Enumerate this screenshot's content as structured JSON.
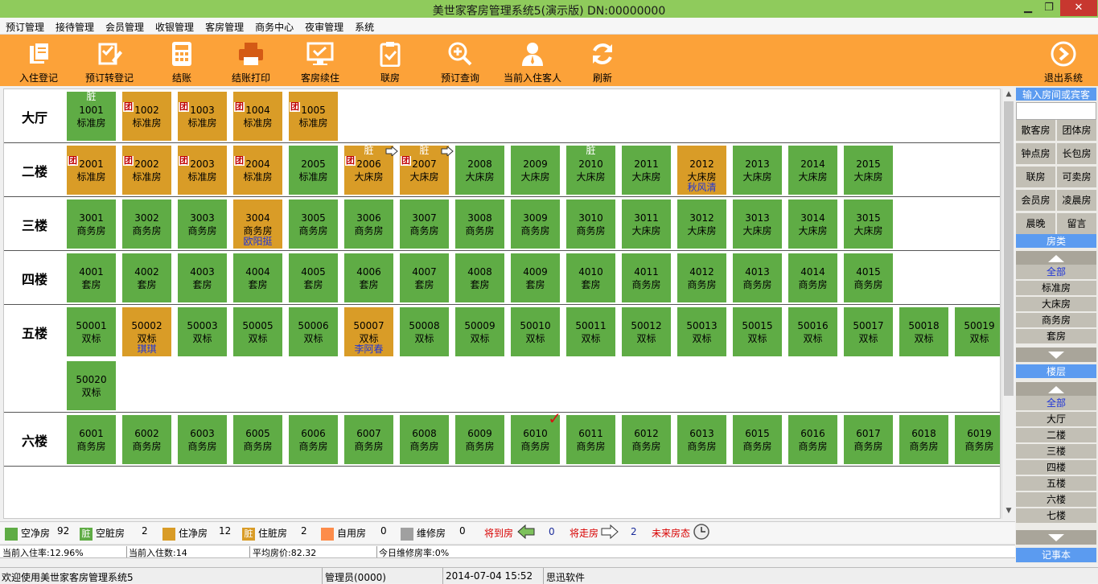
{
  "window": {
    "title": "美世家客房管理系统5(演示版) DN:00000000",
    "min": "▁",
    "restore": "❐",
    "close": "✕"
  },
  "menu": [
    "预订管理",
    "接待管理",
    "会员管理",
    "收银管理",
    "客房管理",
    "商务中心",
    "夜审管理",
    "系统"
  ],
  "toolbar": {
    "buttons": [
      {
        "label": "入住登记",
        "icon": "checkin-icon"
      },
      {
        "label": "预订转登记",
        "icon": "reservation-convert-icon"
      },
      {
        "label": "结账",
        "icon": "calculator-icon"
      },
      {
        "label": "结账打印",
        "icon": "printer-icon"
      },
      {
        "label": "客房续住",
        "icon": "monitor-check-icon"
      },
      {
        "label": "联房",
        "icon": "clipboard-check-icon"
      },
      {
        "label": "预订查询",
        "icon": "search-plus-icon"
      },
      {
        "label": "当前入住客人",
        "icon": "guest-icon"
      },
      {
        "label": "刷新",
        "icon": "refresh-icon"
      }
    ],
    "exit": {
      "label": "退出系统",
      "icon": "exit-arrow-icon"
    }
  },
  "room_markers": {
    "dirty": "脏",
    "group": "团"
  },
  "floors": [
    {
      "name": "大厅",
      "rooms": [
        {
          "no": "1001",
          "type": "标准房",
          "color": "green",
          "dirty": true
        },
        {
          "no": "1002",
          "type": "标准房",
          "color": "orange",
          "group": true
        },
        {
          "no": "1003",
          "type": "标准房",
          "color": "orange",
          "group": true
        },
        {
          "no": "1004",
          "type": "标准房",
          "color": "orange",
          "group": true
        },
        {
          "no": "1005",
          "type": "标准房",
          "color": "orange",
          "group": true
        }
      ]
    },
    {
      "name": "二楼",
      "rooms": [
        {
          "no": "2001",
          "type": "标准房",
          "color": "orange",
          "group": true
        },
        {
          "no": "2002",
          "type": "标准房",
          "color": "orange",
          "group": true
        },
        {
          "no": "2003",
          "type": "标准房",
          "color": "orange",
          "group": true
        },
        {
          "no": "2004",
          "type": "标准房",
          "color": "orange",
          "group": true
        },
        {
          "no": "2005",
          "type": "标准房",
          "color": "green"
        },
        {
          "no": "2006",
          "type": "大床房",
          "color": "orange",
          "group": true,
          "dirty": true,
          "leaving": true
        },
        {
          "no": "2007",
          "type": "大床房",
          "color": "orange",
          "group": true,
          "dirty": true,
          "leaving": true
        },
        {
          "no": "2008",
          "type": "大床房",
          "color": "green"
        },
        {
          "no": "2009",
          "type": "大床房",
          "color": "green"
        },
        {
          "no": "2010",
          "type": "大床房",
          "color": "green",
          "dirty": true
        },
        {
          "no": "2011",
          "type": "大床房",
          "color": "green"
        },
        {
          "no": "2012",
          "type": "大床房",
          "color": "orange",
          "guest": "秋风清"
        },
        {
          "no": "2013",
          "type": "大床房",
          "color": "green"
        },
        {
          "no": "2014",
          "type": "大床房",
          "color": "green"
        },
        {
          "no": "2015",
          "type": "大床房",
          "color": "green"
        }
      ]
    },
    {
      "name": "三楼",
      "rooms": [
        {
          "no": "3001",
          "type": "商务房",
          "color": "green"
        },
        {
          "no": "3002",
          "type": "商务房",
          "color": "green"
        },
        {
          "no": "3003",
          "type": "商务房",
          "color": "green"
        },
        {
          "no": "3004",
          "type": "商务房",
          "color": "orange",
          "guest": "欧阳挺"
        },
        {
          "no": "3005",
          "type": "商务房",
          "color": "green"
        },
        {
          "no": "3006",
          "type": "商务房",
          "color": "green"
        },
        {
          "no": "3007",
          "type": "商务房",
          "color": "green"
        },
        {
          "no": "3008",
          "type": "商务房",
          "color": "green"
        },
        {
          "no": "3009",
          "type": "商务房",
          "color": "green"
        },
        {
          "no": "3010",
          "type": "商务房",
          "color": "green"
        },
        {
          "no": "3011",
          "type": "大床房",
          "color": "green"
        },
        {
          "no": "3012",
          "type": "大床房",
          "color": "green"
        },
        {
          "no": "3013",
          "type": "大床房",
          "color": "green"
        },
        {
          "no": "3014",
          "type": "大床房",
          "color": "green"
        },
        {
          "no": "3015",
          "type": "大床房",
          "color": "green"
        }
      ]
    },
    {
      "name": "四楼",
      "rooms": [
        {
          "no": "4001",
          "type": "套房",
          "color": "green"
        },
        {
          "no": "4002",
          "type": "套房",
          "color": "green"
        },
        {
          "no": "4003",
          "type": "套房",
          "color": "green"
        },
        {
          "no": "4004",
          "type": "套房",
          "color": "green"
        },
        {
          "no": "4005",
          "type": "套房",
          "color": "green"
        },
        {
          "no": "4006",
          "type": "套房",
          "color": "green"
        },
        {
          "no": "4007",
          "type": "套房",
          "color": "green"
        },
        {
          "no": "4008",
          "type": "套房",
          "color": "green"
        },
        {
          "no": "4009",
          "type": "套房",
          "color": "green"
        },
        {
          "no": "4010",
          "type": "套房",
          "color": "green"
        },
        {
          "no": "4011",
          "type": "商务房",
          "color": "green"
        },
        {
          "no": "4012",
          "type": "商务房",
          "color": "green"
        },
        {
          "no": "4013",
          "type": "商务房",
          "color": "green"
        },
        {
          "no": "4014",
          "type": "商务房",
          "color": "green"
        },
        {
          "no": "4015",
          "type": "商务房",
          "color": "green"
        }
      ]
    },
    {
      "name": "五楼",
      "rooms": [
        {
          "no": "50001",
          "type": "双标",
          "color": "green"
        },
        {
          "no": "50002",
          "type": "双标",
          "color": "orange",
          "guest": "琪琪"
        },
        {
          "no": "50003",
          "type": "双标",
          "color": "green"
        },
        {
          "no": "50005",
          "type": "双标",
          "color": "green"
        },
        {
          "no": "50006",
          "type": "双标",
          "color": "green"
        },
        {
          "no": "50007",
          "type": "双标",
          "color": "orange",
          "guest": "李阿春"
        },
        {
          "no": "50008",
          "type": "双标",
          "color": "green"
        },
        {
          "no": "50009",
          "type": "双标",
          "color": "green"
        },
        {
          "no": "50010",
          "type": "双标",
          "color": "green"
        },
        {
          "no": "50011",
          "type": "双标",
          "color": "green"
        },
        {
          "no": "50012",
          "type": "双标",
          "color": "green"
        },
        {
          "no": "50013",
          "type": "双标",
          "color": "green"
        },
        {
          "no": "50015",
          "type": "双标",
          "color": "green"
        },
        {
          "no": "50016",
          "type": "双标",
          "color": "green"
        },
        {
          "no": "50017",
          "type": "双标",
          "color": "green"
        },
        {
          "no": "50018",
          "type": "双标",
          "color": "green"
        },
        {
          "no": "50019",
          "type": "双标",
          "color": "green"
        },
        {
          "no": "50020",
          "type": "双标",
          "color": "green"
        }
      ]
    },
    {
      "name": "六楼",
      "rooms": [
        {
          "no": "6001",
          "type": "商务房",
          "color": "green"
        },
        {
          "no": "6002",
          "type": "商务房",
          "color": "green"
        },
        {
          "no": "6003",
          "type": "商务房",
          "color": "green"
        },
        {
          "no": "6005",
          "type": "商务房",
          "color": "green"
        },
        {
          "no": "6006",
          "type": "商务房",
          "color": "green"
        },
        {
          "no": "6007",
          "type": "商务房",
          "color": "green"
        },
        {
          "no": "6008",
          "type": "商务房",
          "color": "green"
        },
        {
          "no": "6009",
          "type": "商务房",
          "color": "green"
        },
        {
          "no": "6010",
          "type": "商务房",
          "color": "green",
          "checked": true
        },
        {
          "no": "6011",
          "type": "商务房",
          "color": "green"
        },
        {
          "no": "6012",
          "type": "商务房",
          "color": "green"
        },
        {
          "no": "6013",
          "type": "商务房",
          "color": "green"
        },
        {
          "no": "6015",
          "type": "商务房",
          "color": "green"
        },
        {
          "no": "6016",
          "type": "商务房",
          "color": "green"
        },
        {
          "no": "6017",
          "type": "商务房",
          "color": "green"
        },
        {
          "no": "6018",
          "type": "商务房",
          "color": "green"
        },
        {
          "no": "6019",
          "type": "商务房",
          "color": "green"
        }
      ]
    }
  ],
  "colors": {
    "vacant_clean": "#5fac45",
    "occupied": "#d99c27",
    "self_use": "#fd8c4a",
    "maintenance": "#a0a0a0",
    "accent": "#fca239"
  },
  "sidebar": {
    "search_label": "输入房间或宾客",
    "filters": [
      "散客房",
      "团体房",
      "钟点房",
      "长包房",
      "联房",
      "可卖房",
      "会员房",
      "凌晨房",
      "晨晚",
      "留言"
    ],
    "room_type_title": "房类",
    "room_types": [
      "全部",
      "标准房",
      "大床房",
      "商务房",
      "套房"
    ],
    "floor_title": "楼层",
    "floor_list": [
      "全部",
      "大厅",
      "二楼",
      "三楼",
      "四楼",
      "五楼",
      "六楼",
      "七楼"
    ],
    "notes_title": "记事本"
  },
  "legend": [
    {
      "label": "空净房",
      "count": "92"
    },
    {
      "label": "空脏房",
      "count": "2",
      "marker": "脏"
    },
    {
      "label": "住净房",
      "count": "12"
    },
    {
      "label": "住脏房",
      "count": "2",
      "marker": "脏"
    },
    {
      "label": "自用房",
      "count": "0"
    },
    {
      "label": "维修房",
      "count": "0"
    }
  ],
  "legend_extra": {
    "arriving_label": "将到房",
    "arriving_count": "0",
    "leaving_label": "将走房",
    "leaving_count": "2",
    "future_label": "未来房态"
  },
  "info": {
    "occupancy_rate": "当前入住率:12.96%",
    "occupancy_count": "当前入住数:14",
    "avg_price": "平均房价:82.32",
    "maintenance_rate": "今日维修房率:0%"
  },
  "status": {
    "welcome": "欢迎使用美世家客房管理系统5",
    "operator": "管理员(0000)",
    "datetime": "2014-07-04 15:52",
    "company": "思迅软件"
  }
}
